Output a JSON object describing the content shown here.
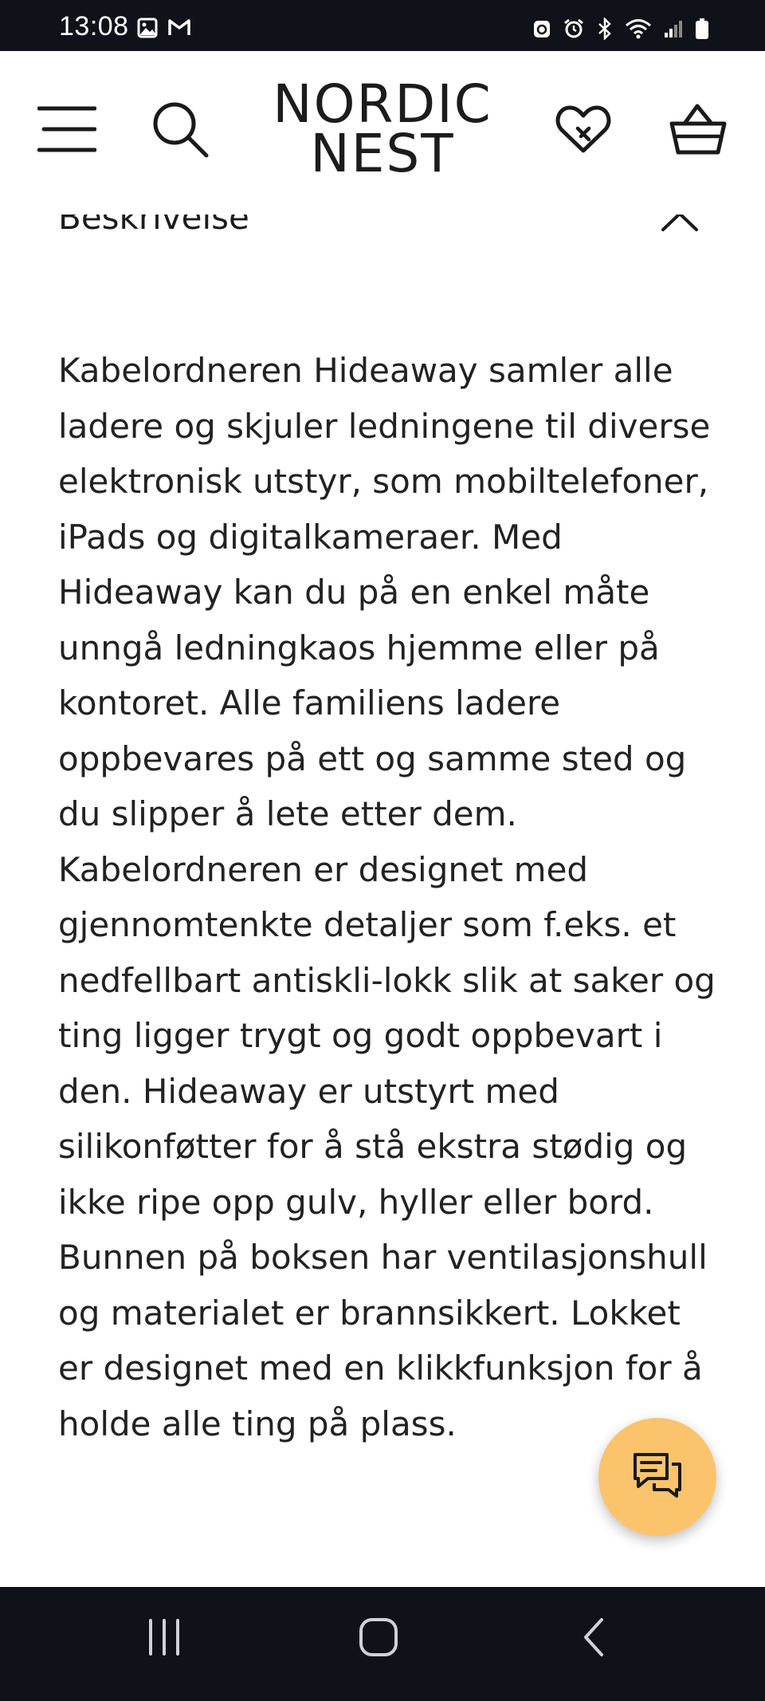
{
  "status_bar": {
    "time": "13:08",
    "left_icons": [
      "image-notification-icon",
      "gmail-icon"
    ],
    "right_icons": [
      "recycle-icon",
      "alarm-icon",
      "bluetooth-icon",
      "wifi-icon",
      "signal-icon",
      "battery-icon"
    ]
  },
  "header": {
    "logo_line1": "NORDIC",
    "logo_line2": "NEST",
    "menu_icon": "menu-icon",
    "search_icon": "search-icon",
    "wishlist_icon": "heart-icon",
    "cart_icon": "basket-icon"
  },
  "section": {
    "heading": "Beskrivelse",
    "toggle_icon": "chevron-up-icon",
    "description": "Kabelordneren Hideaway samler alle ladere og skjuler ledningene til diverse elektronisk utstyr, som mobiltelefoner, iPads og digitalkameraer. Med Hideaway kan du på en enkel måte unngå ledningkaos hjemme eller på kontoret. Alle familiens ladere oppbevares på ett og samme sted og du slipper å lete etter dem. Kabelordneren er designet med gjennomtenkte detaljer som f.eks. et nedfellbart antiskli-lokk slik at saker og ting ligger trygt og godt oppbevart i den. Hideaway er utstyrt med silikonføtter for å stå ekstra stødig og ikke ripe opp gulv, hyller eller bord. Bunnen på boksen har ventilasjonshull og materialet er brannsikkert. Lokket er designet med en klikkfunksjon for å holde alle ting på plass."
  },
  "chat_button": {
    "icon": "chat-icon",
    "color": "#fcc36d"
  },
  "nav_bar": {
    "recents_icon": "recents-icon",
    "home_icon": "home-icon",
    "back_icon": "back-icon"
  },
  "colors": {
    "system_bar": "#0f1319",
    "chat_fab": "#fcc36d",
    "text": "#222222"
  }
}
